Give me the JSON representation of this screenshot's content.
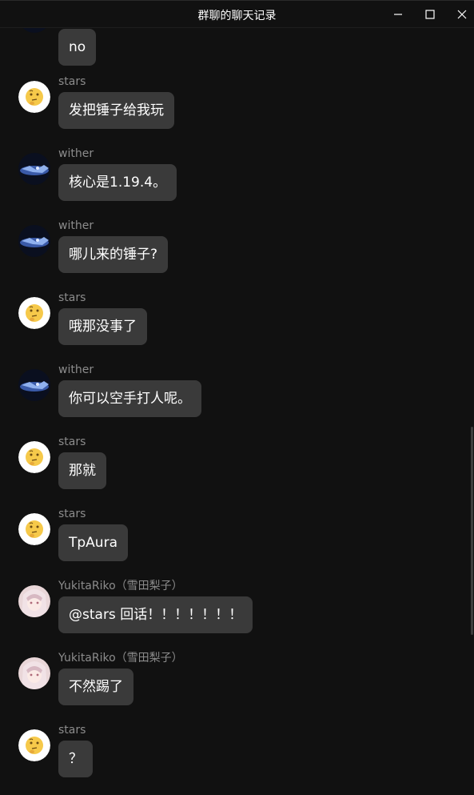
{
  "window": {
    "title": "群聊的聊天记录",
    "controls": [
      "minimize-icon",
      "maximize-icon",
      "close-icon"
    ]
  },
  "colors": {
    "background": "#111111",
    "bubble": "#3a3a3a",
    "sender_name": "#8c8c8c",
    "text": "#ffffff"
  },
  "messages": [
    {
      "sender": "",
      "text": "no",
      "avatar": "wither-avatar-icon"
    },
    {
      "sender": "stars",
      "text": "发把锤子给我玩",
      "avatar": "thinking-face-avatar-icon"
    },
    {
      "sender": "wither",
      "text": "核心是1.19.4。",
      "avatar": "wither-avatar-icon"
    },
    {
      "sender": "wither",
      "text": "哪儿来的锤子?",
      "avatar": "wither-avatar-icon"
    },
    {
      "sender": "stars",
      "text": "哦那没事了",
      "avatar": "thinking-face-avatar-icon"
    },
    {
      "sender": "wither",
      "text": "你可以空手打人呢。",
      "avatar": "wither-avatar-icon"
    },
    {
      "sender": "stars",
      "text": "那就",
      "avatar": "thinking-face-avatar-icon"
    },
    {
      "sender": "stars",
      "text": "TpAura",
      "avatar": "thinking-face-avatar-icon"
    },
    {
      "sender": "YukitaRiko（雪田梨子）",
      "text": "@stars 回话！！！！！！！",
      "avatar": "anime-girl-avatar-icon"
    },
    {
      "sender": "YukitaRiko（雪田梨子）",
      "text": "不然踢了",
      "avatar": "anime-girl-avatar-icon"
    },
    {
      "sender": "stars",
      "text": "？",
      "avatar": "thinking-face-avatar-icon"
    }
  ]
}
